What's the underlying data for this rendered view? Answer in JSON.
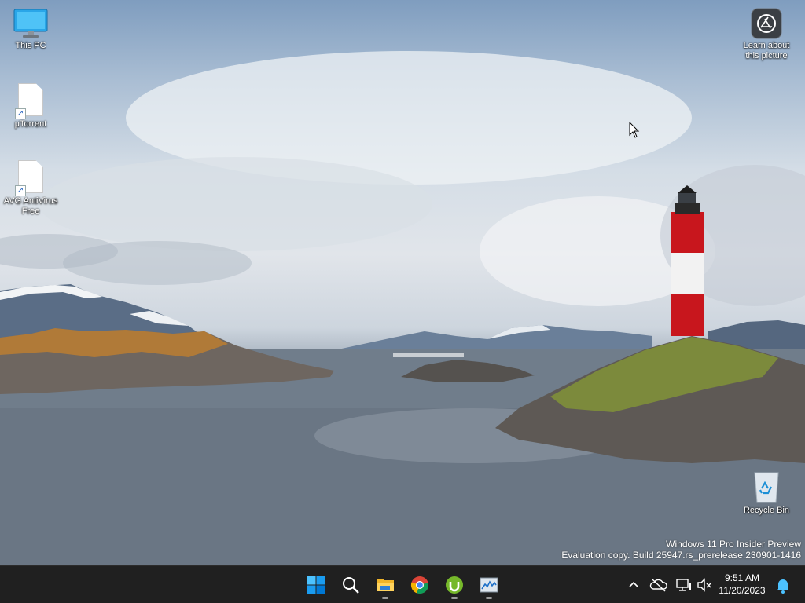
{
  "desktop": {
    "icons": [
      {
        "label": "This PC",
        "icon": "monitor-icon"
      },
      {
        "label": "µTorrent",
        "icon": "file-icon"
      },
      {
        "label": "AVG AntiVirus Free",
        "icon": "file-icon"
      },
      {
        "label": "Learn about this picture",
        "icon": "camera-icon"
      },
      {
        "label": "Recycle Bin",
        "icon": "recycle-bin-icon"
      }
    ],
    "watermark": {
      "line1": "Windows 11 Pro Insider Preview",
      "line2": "Evaluation copy. Build 25947.rs_prerelease.230901-1416"
    }
  },
  "taskbar": {
    "apps": [
      {
        "name": "Start",
        "icon": "windows-start-icon"
      },
      {
        "name": "Search",
        "icon": "search-icon"
      },
      {
        "name": "File Explorer",
        "icon": "folder-icon",
        "running": true
      },
      {
        "name": "Google Chrome",
        "icon": "chrome-icon"
      },
      {
        "name": "µTorrent",
        "icon": "utorrent-icon",
        "running": true
      },
      {
        "name": "Task Manager",
        "icon": "task-manager-icon",
        "running": true
      }
    ],
    "tray": {
      "icons": [
        "chevron-up-icon",
        "onedrive-offline-icon",
        "network-icon",
        "volume-muted-icon",
        "notification-bell-icon"
      ],
      "time": "9:51 AM",
      "date": "11/20/2023"
    }
  },
  "colors": {
    "taskbar_bg": "#202020",
    "windows_accent": "#0078d4",
    "lighthouse_red": "#c8161d"
  }
}
